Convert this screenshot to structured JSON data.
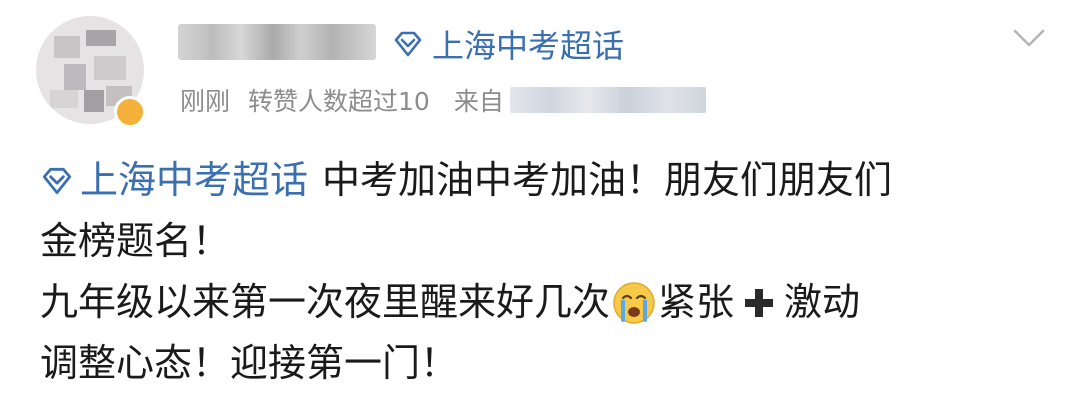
{
  "post": {
    "topic_label": "上海中考超话",
    "meta": {
      "time": "刚刚",
      "reposts": "转赞人数超过10",
      "source_prefix": "来自"
    },
    "content": {
      "topic_label": "上海中考超话",
      "line1_text": "中考加油中考加油！朋友们朋友们",
      "line2_text": "金榜题名！",
      "line3_before_emoji": "九年级以来第一次夜里醒来好几次",
      "line3_after_emoji": "紧张",
      "line3_after_plus": "激动",
      "line4_text": "调整心态！迎接第一门！"
    },
    "icons": {
      "topic_icon": "super-topic-diamond-icon",
      "menu": "chevron-down-icon",
      "emoji": "crying-face-emoji",
      "plus": "heavy-plus-icon"
    },
    "colors": {
      "link": "#3a6fb0",
      "meta": "#8c8c8c",
      "text": "#1a1a1a",
      "badge": "#f6b13b"
    }
  }
}
